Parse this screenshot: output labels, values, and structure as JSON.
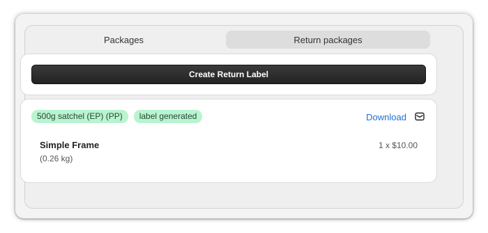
{
  "tabs": [
    {
      "label": "Packages",
      "active": true
    },
    {
      "label": "Return packages",
      "active": false
    }
  ],
  "actions": {
    "create_return_label": "Create Return Label"
  },
  "package": {
    "badges": [
      "500g satchel (EP) (PP)",
      "label generated"
    ],
    "download_label": "Download",
    "icon": "mail-icon",
    "item": {
      "name": "Simple Frame",
      "weight": "(0.26 kg)",
      "qty_price": "1 x $10.00"
    }
  },
  "colors": {
    "badge_bg": "#b9f3cf",
    "link": "#1f6fd1",
    "button": "#2b2b2b"
  }
}
